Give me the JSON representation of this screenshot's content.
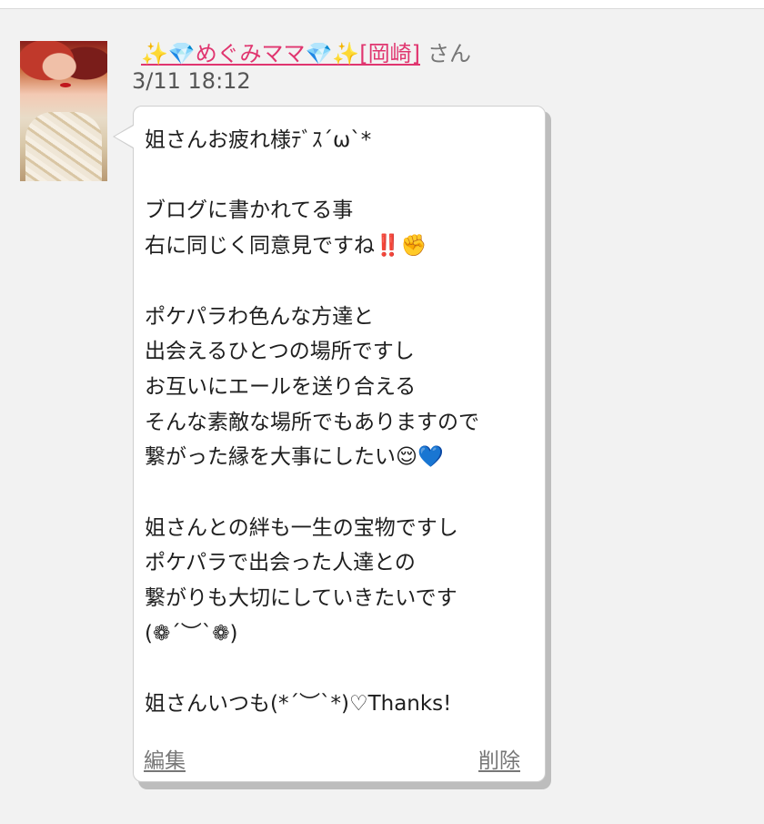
{
  "post": {
    "author": {
      "display_name": "✨💎めぐみママ💎✨[岡崎]",
      "suffix": "さん"
    },
    "timestamp": "3/11 18:12",
    "message": "姐さんお疲れ様ﾃﾞｽ´ω`*\n\nブログに書かれてる事\n右に同じく同意見ですね‼️✊\n\nポケパラわ色んな方達と\n出会えるひとつの場所ですし\nお互いにエールを送り合える\nそんな素敵な場所でもありますので\n繋がった縁を大事にしたい😌💙\n\n姐さんとの絆も一生の宝物ですし\nポケパラで出会った人達との\n繋がりも大切にしていきたいです\n(❁´︶`❁)\n\n姐さんいつも(*´︶`*)♡Thanks!",
    "actions": {
      "edit": "編集",
      "delete": "削除"
    }
  },
  "colors": {
    "background": "#f2f2f2",
    "author_link": "#e0356f",
    "timestamp": "#555555",
    "action_link": "#777777"
  },
  "icons": {
    "avatar": "user-photo"
  }
}
